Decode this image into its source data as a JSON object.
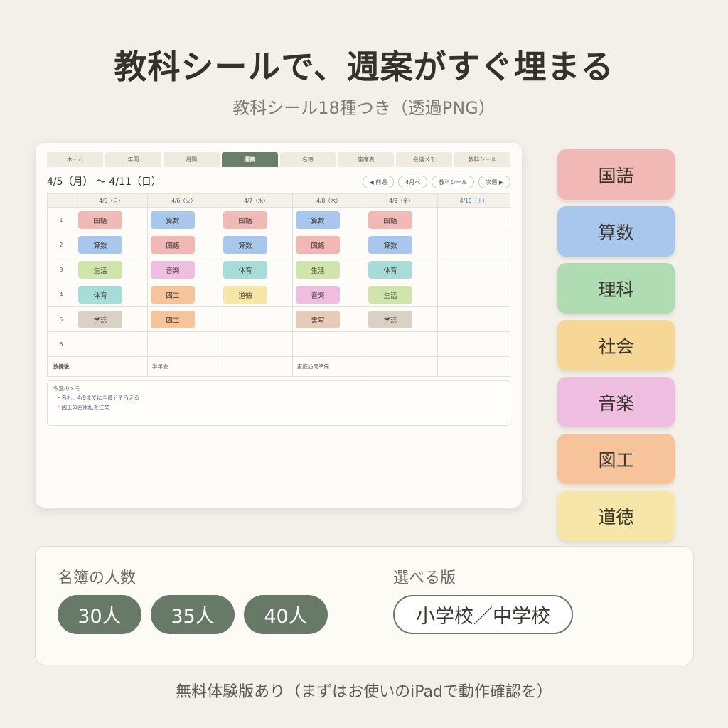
{
  "headline": "教科シールで、週案がすぐ埋まる",
  "subline": "教科シール18種つき（透過PNG）",
  "app": {
    "tabs": [
      {
        "label": "ホーム",
        "active": false
      },
      {
        "label": "年間",
        "active": false
      },
      {
        "label": "月間",
        "active": false
      },
      {
        "label": "週案",
        "active": true
      },
      {
        "label": "名簿",
        "active": false
      },
      {
        "label": "座席表",
        "active": false
      },
      {
        "label": "会議メモ",
        "active": false
      },
      {
        "label": "教科シール",
        "active": false
      }
    ],
    "date_range": "4/5（月） 〜 4/11（日）",
    "nav": {
      "prev": "◀ 前週",
      "month": "4月へ",
      "stickers": "教科シール",
      "next": "次週 ▶"
    },
    "days": [
      "4/5（月）",
      "4/6（火）",
      "4/7（水）",
      "4/8（木）",
      "4/9（金）",
      "4/10（土）"
    ],
    "periods": [
      {
        "label": "1",
        "cells": [
          "国語",
          "算数",
          "国語",
          "算数",
          "国語",
          ""
        ]
      },
      {
        "label": "2",
        "cells": [
          "算数",
          "国語",
          "算数",
          "国語",
          "算数",
          ""
        ]
      },
      {
        "label": "3",
        "cells": [
          "生活",
          "音楽",
          "体育",
          "生活",
          "体育",
          ""
        ]
      },
      {
        "label": "4",
        "cells": [
          "体育",
          "図工",
          "道徳",
          "音楽",
          "生活",
          ""
        ]
      },
      {
        "label": "5",
        "cells": [
          "学活",
          "図工",
          "",
          "書写",
          "学活",
          ""
        ]
      },
      {
        "label": "6",
        "cells": [
          "",
          "",
          "",
          "",
          "",
          ""
        ]
      }
    ],
    "after_school": {
      "label": "放課後",
      "cells": [
        "",
        "学年会",
        "",
        "家庭訪問準備",
        "",
        ""
      ]
    },
    "memo": {
      "title": "今週のメモ",
      "lines": [
        "・名札、4/9までに全員分そろえる",
        "・図工の画用紙を注文"
      ]
    }
  },
  "subject_colors": {
    "国語": "#f2b8b5",
    "算数": "#a9c7ec",
    "理科": "#b0dcb3",
    "社会": "#f6d796",
    "音楽": "#efbde0",
    "図工": "#f6c39b",
    "道徳": "#f6e7a9",
    "生活": "#cfe5a9",
    "体育": "#a6ddd8",
    "学活": "#d9d1c3",
    "書写": "#e7cbb7"
  },
  "samples": [
    "国語",
    "算数",
    "理科",
    "社会",
    "音楽",
    "図工",
    "道徳"
  ],
  "options": {
    "roster_label": "名簿の人数",
    "roster_sizes": [
      "30人",
      "35人",
      "40人"
    ],
    "edition_label": "選べる版",
    "edition": "小学校／中学校"
  },
  "footer": "無料体験版あり（まずはお使いのiPadで動作確認を）"
}
